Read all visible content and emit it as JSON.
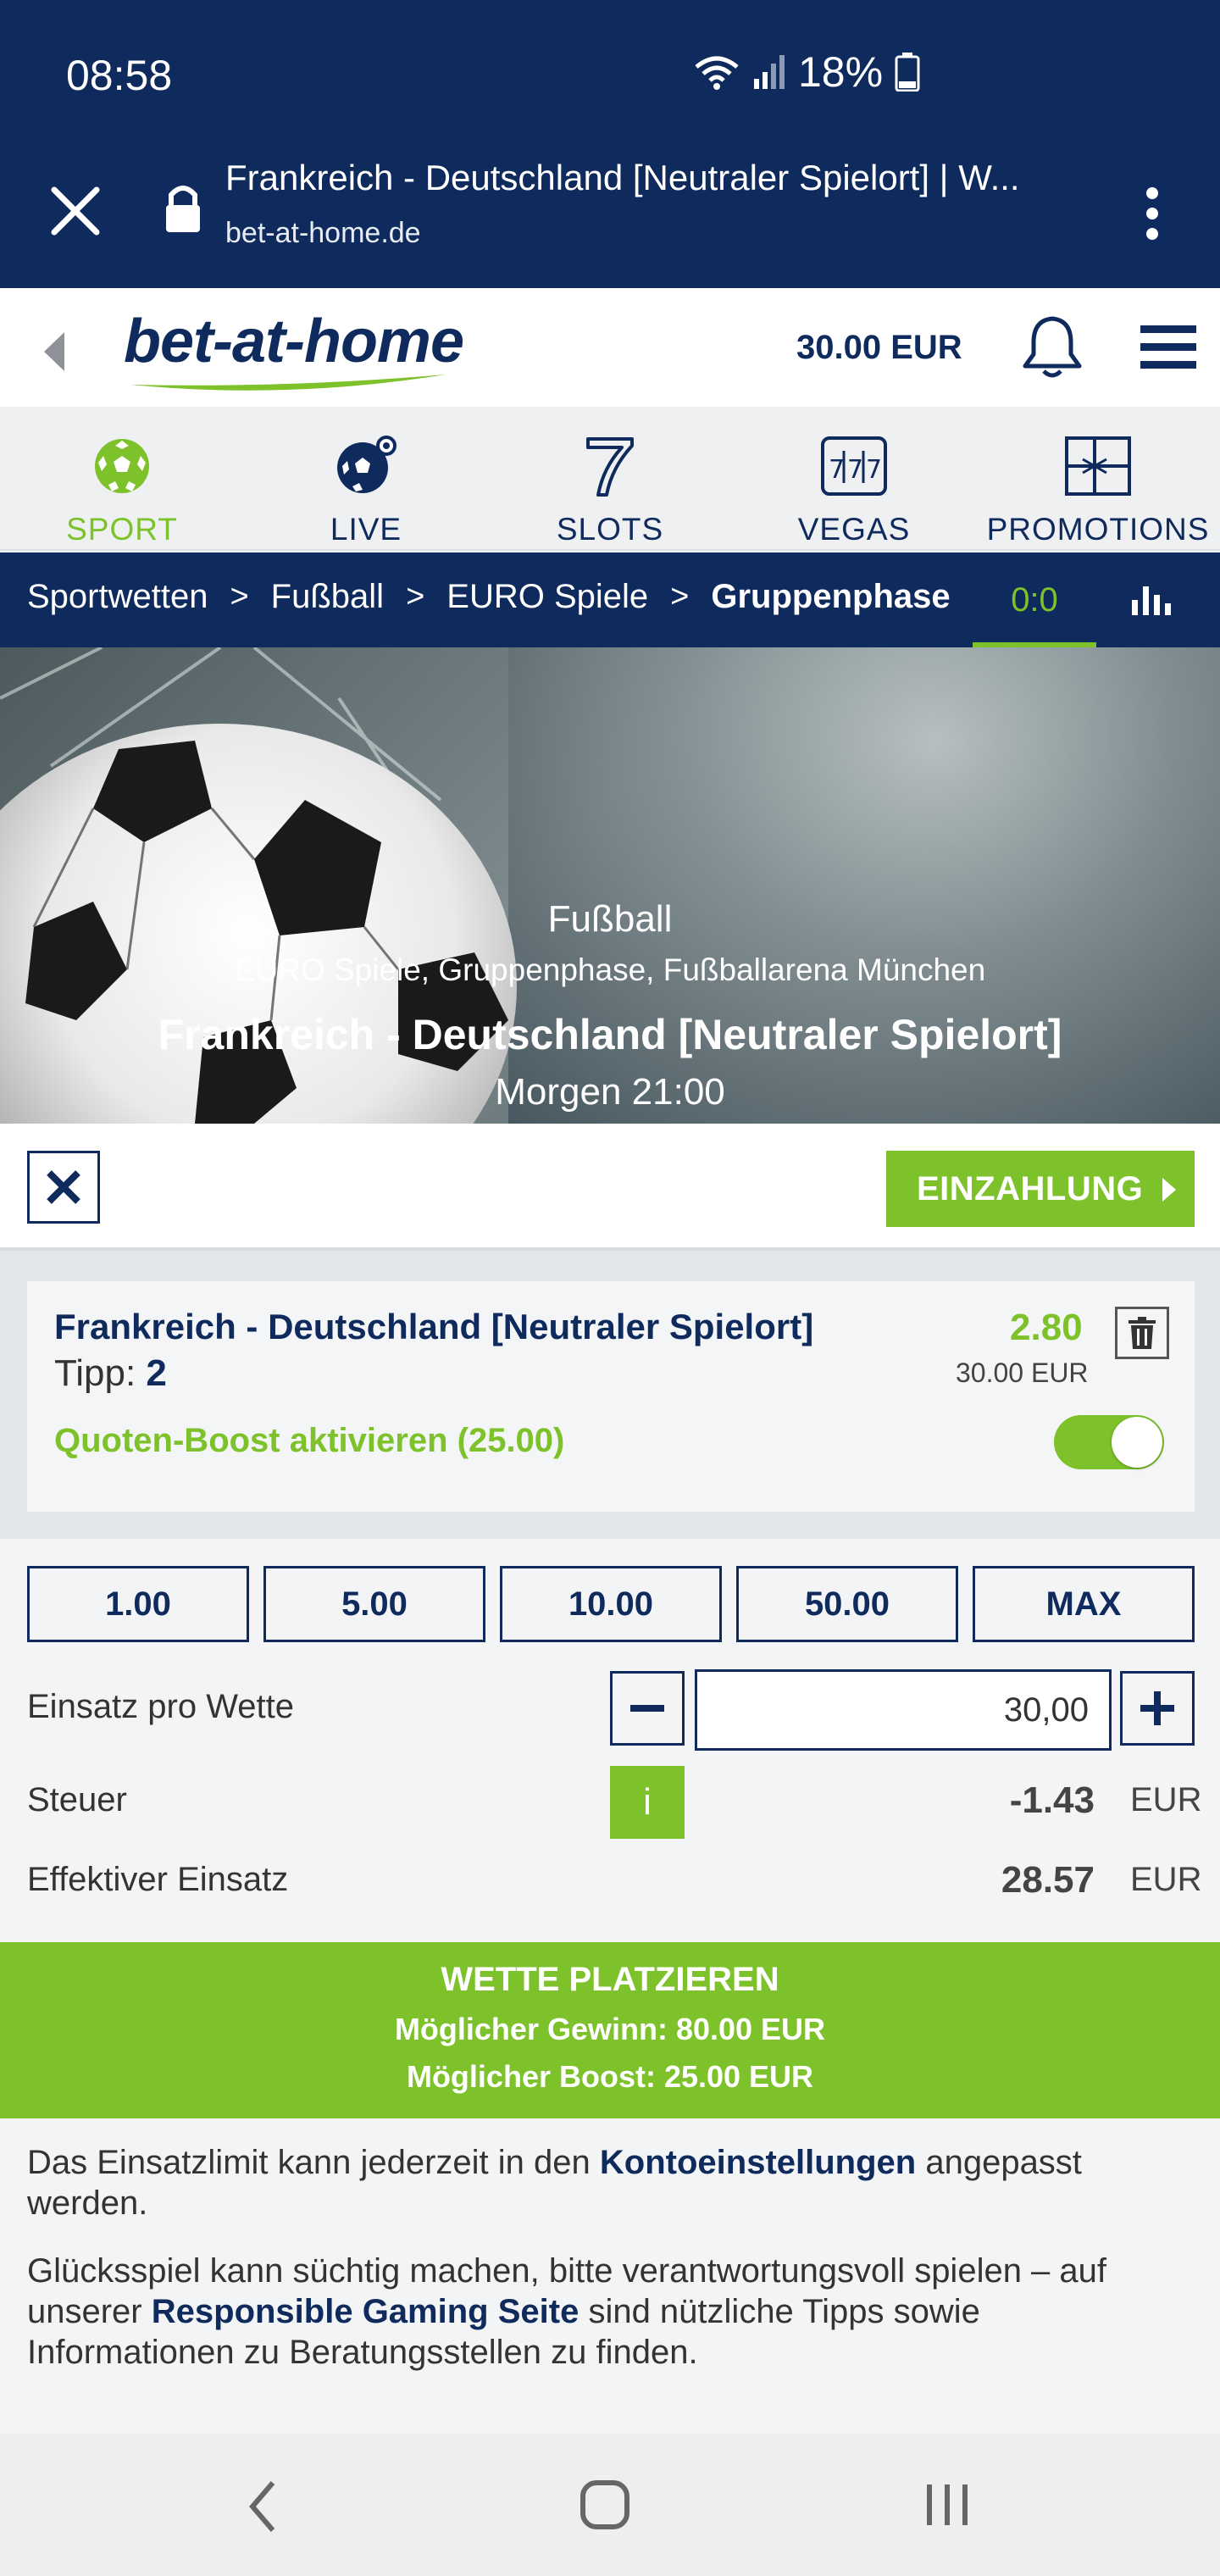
{
  "status_bar": {
    "time": "08:58",
    "battery": "18%"
  },
  "browser": {
    "title": "Frankreich - Deutschland [Neutraler Spielort] | W...",
    "url": "bet-at-home.de"
  },
  "header": {
    "logo": "bet-at-home",
    "balance": "30.00 EUR"
  },
  "nav": {
    "items": [
      {
        "label": "SPORT"
      },
      {
        "label": "LIVE"
      },
      {
        "label": "SLOTS"
      },
      {
        "label": "VEGAS"
      },
      {
        "label": "PROMOTIONS"
      }
    ]
  },
  "breadcrumb": {
    "items": [
      "Sportwetten",
      "Fußball",
      "EURO Spiele",
      "Gruppenphase"
    ],
    "score": "0:0"
  },
  "hero": {
    "sport": "Fußball",
    "details": "EURO Spiele, Gruppenphase, Fußballarena München",
    "match": "Frankreich - Deutschland [Neutraler Spielort]",
    "time": "Morgen 21:00"
  },
  "actions": {
    "deposit": "EINZAHLUNG"
  },
  "bet": {
    "match": "Frankreich - Deutschland [Neutraler Spielort]",
    "tipp_label": "Tipp:",
    "tipp_value": "2",
    "odds": "2.80",
    "stake": "30.00 EUR",
    "boost": "Quoten-Boost aktivieren (25.00)"
  },
  "stakes": {
    "chips": [
      "1.00",
      "5.00",
      "10.00",
      "50.00",
      "MAX"
    ],
    "stake_label": "Einsatz pro Wette",
    "stake_value": "30,00",
    "tax_label": "Steuer",
    "tax_info": "i",
    "tax_value": "-1.43",
    "tax_currency": "EUR",
    "effective_label": "Effektiver Einsatz",
    "effective_value": "28.57",
    "effective_currency": "EUR"
  },
  "place_bet": {
    "label": "WETTE PLATZIEREN",
    "win": "Möglicher Gewinn: 80.00 EUR",
    "boost": "Möglicher Boost: 25.00 EUR"
  },
  "info": {
    "p1_pre": "Das Einsatzlimit kann jederzeit in den ",
    "p1_link": "Kontoeinstellungen",
    "p1_post": " angepasst werden.",
    "p2_pre": "Glücksspiel kann süchtig machen, bitte verantwortungsvoll spielen – auf unserer ",
    "p2_link": "Responsible Gaming Seite",
    "p2_post": " sind nützliche Tipps sowie Informationen zu Beratungsstellen zu finden."
  },
  "colors": {
    "navy": "#0f2a5c",
    "green": "#7dc22a"
  }
}
